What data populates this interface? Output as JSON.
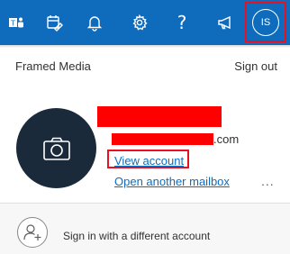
{
  "topbar": {
    "icons": [
      "teams-icon",
      "calendar-edit-icon",
      "bell-icon",
      "gear-icon",
      "help-icon",
      "megaphone-icon"
    ],
    "help_label": "?",
    "avatar_initials": "IS",
    "background": "#0f6cbd"
  },
  "account": {
    "organization": "Framed Media",
    "sign_out": "Sign out",
    "email_domain": ".com",
    "view_account": "View account",
    "open_other_mailbox": "Open another mailbox",
    "more_label": "..."
  },
  "footer": {
    "sign_in_different": "Sign in with a different account"
  },
  "colors": {
    "accent": "#0f6cbd",
    "highlight": "#e81123",
    "redaction": "#ff0000",
    "avatar_bg": "#1b2a3a"
  }
}
